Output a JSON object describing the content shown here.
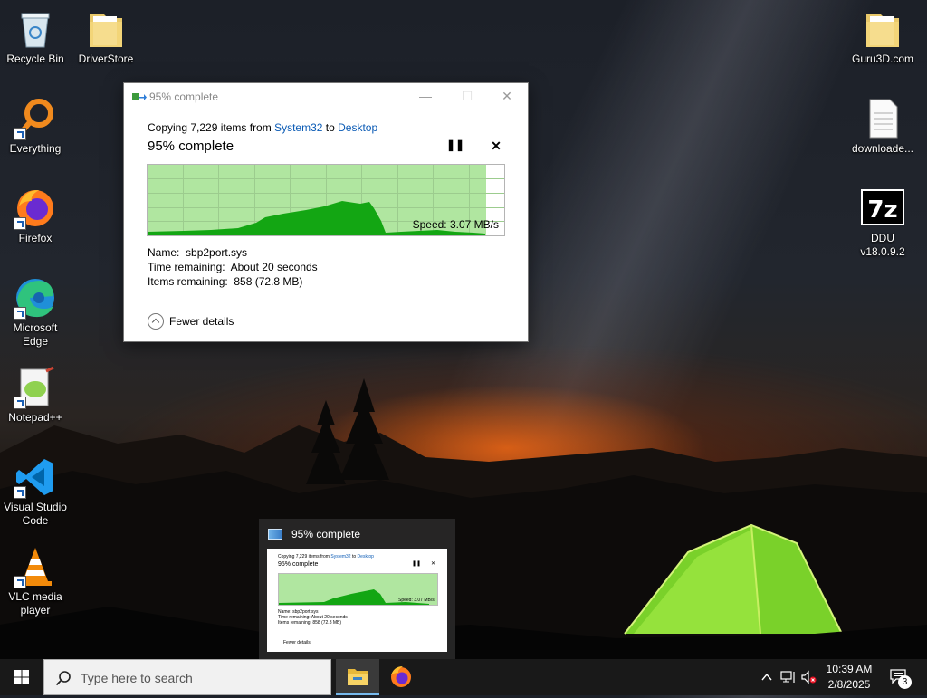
{
  "desktop": {
    "left_icons": [
      {
        "label": "Recycle Bin",
        "icon": "recycle-bin-icon"
      },
      {
        "label": "DriverStore",
        "icon": "folder-icon"
      },
      {
        "label": "Everything",
        "icon": "everything-search-icon"
      },
      {
        "label": "Firefox",
        "icon": "firefox-icon"
      },
      {
        "label": "Microsoft Edge",
        "icon": "edge-icon"
      },
      {
        "label": "Notepad++",
        "icon": "notepad-plus-plus-icon"
      },
      {
        "label": "Visual Studio Code",
        "icon": "vscode-icon"
      },
      {
        "label": "VLC media player",
        "icon": "vlc-icon"
      }
    ],
    "right_icons": [
      {
        "label": "Guru3D.com",
        "icon": "folder-icon"
      },
      {
        "label": "downloade...",
        "icon": "document-icon"
      },
      {
        "label": "DDU v18.0.9.2",
        "icon": "7zip-icon"
      }
    ]
  },
  "copy_dialog": {
    "title": "95% complete",
    "copy_prefix": "Copying 7,229 items from ",
    "source": "System32",
    "to_word": " to ",
    "destination": "Desktop",
    "percent_text": "95% complete",
    "progress_percent": 95,
    "speed": "Speed: 3.07 MB/s",
    "name_label": "Name:",
    "name_value": "sbp2port.sys",
    "time_label": "Time remaining:",
    "time_value": "About 20 seconds",
    "items_label": "Items remaining:",
    "items_value": "858 (72.8 MB)",
    "fewer_details": "Fewer details",
    "window_buttons": {
      "minimize": "—",
      "maximize": "☐",
      "close": "✕"
    },
    "pause_glyph": "❚❚",
    "cancel_glyph": "✕"
  },
  "thumbnail": {
    "title": "95% complete",
    "copy_prefix": "Copying 7,229 items from ",
    "source": "System32",
    "to_word": " to ",
    "destination": "Desktop",
    "percent_text": "95% complete",
    "speed": "Speed: 3.07 MB/s",
    "name_line": "Name: sbp2port.sys",
    "time_line": "Time remaining: About 20 seconds",
    "items_line": "Items remaining: 858 (72.8 MB)",
    "fewer_details": "Fewer details"
  },
  "taskbar": {
    "search_placeholder": "Type here to search",
    "apps": [
      "file-explorer-icon",
      "firefox-icon"
    ],
    "active_app": "File Explorer",
    "time": "10:39 AM",
    "date": "2/8/2025",
    "notification_count": "3"
  },
  "colors": {
    "progress_fill": "#b0e6a0",
    "graph_green": "#13a613",
    "link_blue": "#0b5bb5",
    "taskbar": "#191919"
  }
}
